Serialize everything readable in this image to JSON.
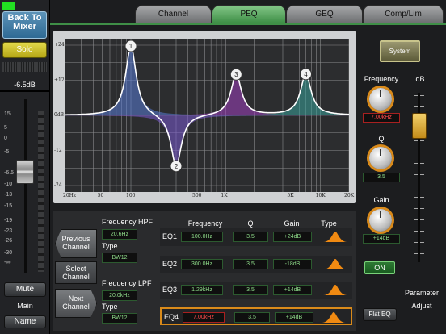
{
  "left": {
    "back_label": "Back To Mixer",
    "solo_label": "Solo",
    "level_readout": "-6.5dB",
    "scale": [
      "15",
      "5",
      "0",
      "-5",
      "-6.5",
      "-10",
      "-13",
      "-15",
      "-19",
      "-23",
      "-26",
      "-30",
      "-∞"
    ],
    "mute_label": "Mute",
    "channel_name": "Main",
    "name_label": "Name"
  },
  "tabs": [
    {
      "label": "Channel",
      "active": false
    },
    {
      "label": "PEQ",
      "active": true
    },
    {
      "label": "GEQ",
      "active": false
    },
    {
      "label": "Comp/Lim",
      "active": false
    }
  ],
  "graph": {
    "y_ticks": [
      "+24",
      "+12",
      "0dB",
      "-12",
      "-24"
    ],
    "x_ticks": [
      "20Hz",
      "50",
      "100",
      "500",
      "1K",
      "5K",
      "10K",
      "20K"
    ],
    "bands": [
      {
        "id": "1",
        "freq_hz": 100,
        "gain_db": 24,
        "color": "#5a7cd6"
      },
      {
        "id": "2",
        "freq_hz": 300,
        "gain_db": -18,
        "color": "#7a5ad0"
      },
      {
        "id": "3",
        "freq_hz": 1290,
        "gain_db": 14,
        "color": "#a040c0"
      },
      {
        "id": "4",
        "freq_hz": 7000,
        "gain_db": 14,
        "color": "#3aa29a"
      }
    ]
  },
  "right": {
    "system_label": "System",
    "frequency_label": "Frequency",
    "frequency_value": "7.00kHz",
    "q_label": "Q",
    "q_value": "3.5",
    "gain_label": "Gain",
    "gain_value": "+14dB",
    "db_label": "dB",
    "on_label": "ON",
    "param_adjust_label": "Parameter Adjust",
    "flat_eq_label": "Flat EQ",
    "accent": "#d98a1a"
  },
  "filters": {
    "prev_label": "Previous Channel",
    "select_label": "Select Channel",
    "next_label": "Next Channel",
    "hpf": {
      "title": "Frequency HPF",
      "freq": "20.6Hz",
      "type_label": "Type",
      "type": "BW12"
    },
    "lpf": {
      "title": "Frequency LPF",
      "freq": "20.0kHz",
      "type_label": "Type",
      "type": "BW12"
    }
  },
  "eq_table": {
    "headers": {
      "frequency": "Frequency",
      "q": "Q",
      "gain": "Gain",
      "type": "Type"
    },
    "rows": [
      {
        "label": "EQ1",
        "frequency": "100.0Hz",
        "q": "3.5",
        "gain": "+24dB",
        "selected": false
      },
      {
        "label": "EQ2",
        "frequency": "300.0Hz",
        "q": "3.5",
        "gain": "-18dB",
        "selected": false
      },
      {
        "label": "EQ3",
        "frequency": "1.29kHz",
        "q": "3.5",
        "gain": "+14dB",
        "selected": false
      },
      {
        "label": "EQ4",
        "frequency": "7.00kHz",
        "q": "3.5",
        "gain": "+14dB",
        "selected": true
      }
    ]
  }
}
